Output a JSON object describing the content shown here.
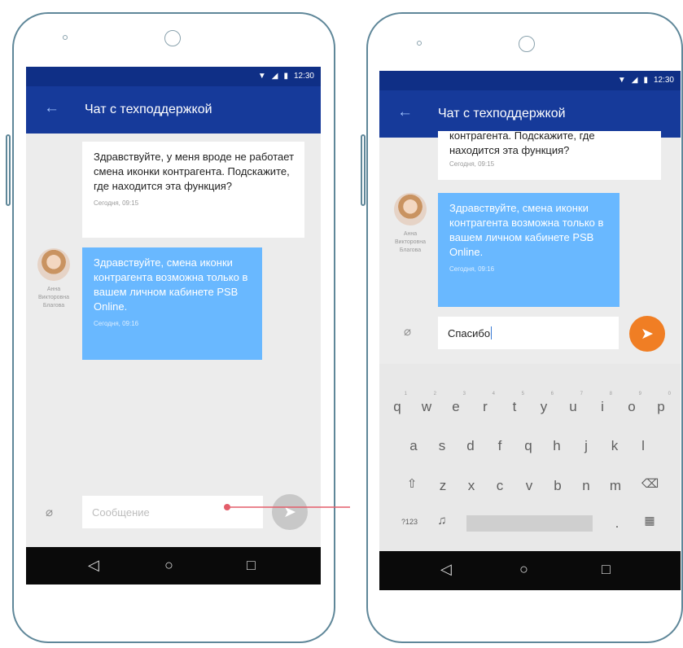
{
  "phone_left": {
    "status": {
      "time": "12:30"
    },
    "appbar": {
      "title": "Чат с техподдержкой",
      "back_icon": "arrow-left-icon"
    },
    "messages": {
      "user": {
        "text": "Здравствуйте, у меня вроде не работает смена иконки контрагента. Подскажите, где находится эта функция?",
        "time": "Сегодня, 09:15"
      },
      "support": {
        "text": "Здравствуйте, смена иконки контрагента возможна только в вашем личном кабинете PSB Online.",
        "time": "Сегодня, 09:16"
      }
    },
    "agent": {
      "name": "Анна Викторовна Благова"
    },
    "input": {
      "placeholder": "Сообщение"
    }
  },
  "phone_right": {
    "status": {
      "time": "12:30"
    },
    "appbar": {
      "title": "Чат с техподдержкой",
      "back_icon": "arrow-left-icon"
    },
    "messages": {
      "user_partial": {
        "line1": "контрагента. Подскажите, где",
        "line2": "находится эта функция?",
        "time": "Сегодня, 09:15"
      },
      "support": {
        "text": "Здравствуйте, смена иконки контрагента возможна только в вашем личном кабинете PSB Online.",
        "time": "Сегодня, 09:16"
      }
    },
    "agent": {
      "name": "Анна Викторовна Благова"
    },
    "input": {
      "value": "Спасибо"
    },
    "keyboard": {
      "row1": [
        "q",
        "w",
        "e",
        "r",
        "t",
        "y",
        "u",
        "i",
        "o",
        "p"
      ],
      "row1_digits": [
        "1",
        "2",
        "3",
        "4",
        "5",
        "6",
        "7",
        "8",
        "9",
        "0"
      ],
      "row2": [
        "a",
        "s",
        "d",
        "f",
        "q",
        "h",
        "j",
        "k",
        "l"
      ],
      "row3": [
        "z",
        "x",
        "c",
        "v",
        "b",
        "n",
        "m"
      ],
      "symbols_key": "?123",
      "period_key": "."
    }
  },
  "colors": {
    "statusbar": "#0f2f86",
    "appbar": "#163a9a",
    "support_bubble": "#69b8ff",
    "send_active": "#f07e24",
    "send_inactive": "#c8c8c8",
    "connector": "#e35d6a"
  }
}
